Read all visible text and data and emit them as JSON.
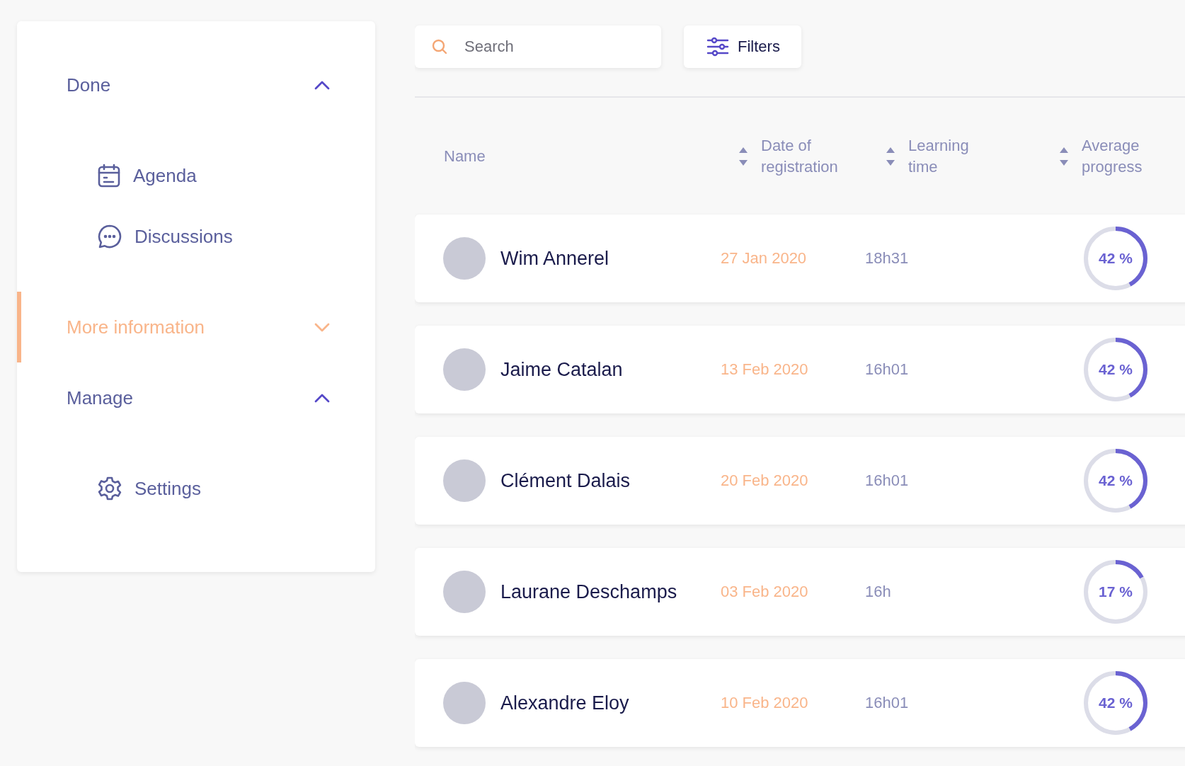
{
  "sidebar": {
    "sections": [
      {
        "label": "Done",
        "expanded": true,
        "selected": false,
        "children": [
          {
            "label": "Agenda",
            "kind": "calendar"
          },
          {
            "label": "Discussions",
            "kind": "chat"
          }
        ]
      },
      {
        "label": "More information",
        "expanded": false,
        "selected": true
      },
      {
        "label": "Manage",
        "expanded": true,
        "selected": false,
        "children": [
          {
            "label": "Settings",
            "kind": "gear"
          }
        ]
      }
    ]
  },
  "toolbar": {
    "search": {
      "placeholder": "Search"
    },
    "filter_button": "Filters"
  },
  "table": {
    "columns": [
      {
        "label": "Name",
        "sortable": false
      },
      {
        "label": "Date of registration",
        "sortable": true
      },
      {
        "label": "Learning time",
        "sortable": true
      },
      {
        "label": "Average progress",
        "sortable": true
      }
    ],
    "rows": [
      {
        "name": "Wim Annerel",
        "date": "27 Jan 2020",
        "time": "18h31",
        "progress": "42 %",
        "level": 0.42
      },
      {
        "name": "Jaime Catalan",
        "date": "13 Feb 2020",
        "time": "16h01",
        "progress": "42 %",
        "level": 0.42
      },
      {
        "name": "Clément Dalais",
        "date": "20 Feb 2020",
        "time": "16h01",
        "progress": "42 %",
        "level": 0.42
      },
      {
        "name": "Laurane Deschamps",
        "date": "03 Feb 2020",
        "time": "16h",
        "progress": "17 %",
        "level": 0.17
      },
      {
        "name": "Alexandre Eloy",
        "date": "10 Feb 2020",
        "time": "16h01",
        "progress": "42 %",
        "level": 0.42
      }
    ]
  }
}
